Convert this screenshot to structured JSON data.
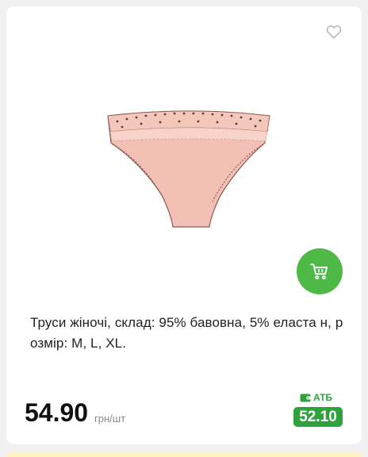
{
  "product": {
    "title": "Труси жіночі, склад: 95% бавовна, 5% еласта н, розмір: M, L, XL.",
    "price": "54.90",
    "unit": "грн/шт",
    "image_icon": "product-photo-panties"
  },
  "promo": {
    "brand": "АТБ",
    "price": "52.10",
    "icon": "wallet-icon"
  },
  "icons": {
    "wishlist": "heart-icon",
    "cart": "cart-icon"
  },
  "colors": {
    "accent": "#4fb948",
    "promo": "#2ea33d",
    "product_pink": "#f2c0b4"
  }
}
